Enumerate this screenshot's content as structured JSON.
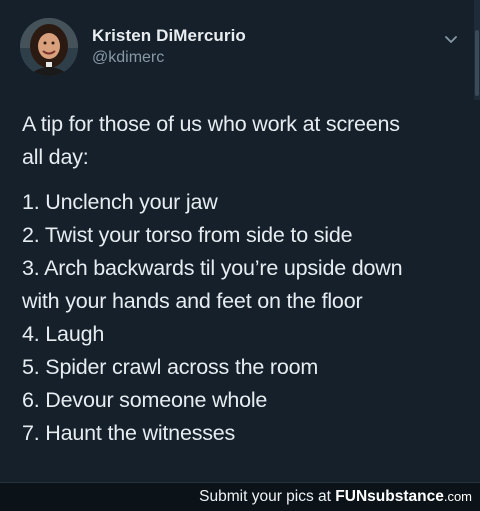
{
  "tweet": {
    "author_name": "Kristen DiMercurio",
    "author_handle": "@kdimerc",
    "intro_line1": "A tip for those of us who work at screens",
    "intro_line2": "all day:",
    "list": [
      "1. Unclench your jaw",
      "2. Twist your torso from side to side",
      "3. Arch backwards til you’re upside down",
      "with your hands and feet on the floor",
      "4. Laugh",
      "5. Spider crawl across the room",
      "6. Devour someone whole",
      "7. Haunt the witnesses"
    ]
  },
  "footer": {
    "submit_text": "Submit your pics at",
    "brand_fun": "FUN",
    "brand_substance": "substance",
    "brand_dotcom": ".com"
  },
  "colors": {
    "background": "#15202b",
    "text": "#e6ecf0",
    "handle": "#8899a6",
    "footer_bg": "#0c1318"
  },
  "icons": {
    "caret": "chevron-down-icon",
    "avatar": "avatar"
  }
}
